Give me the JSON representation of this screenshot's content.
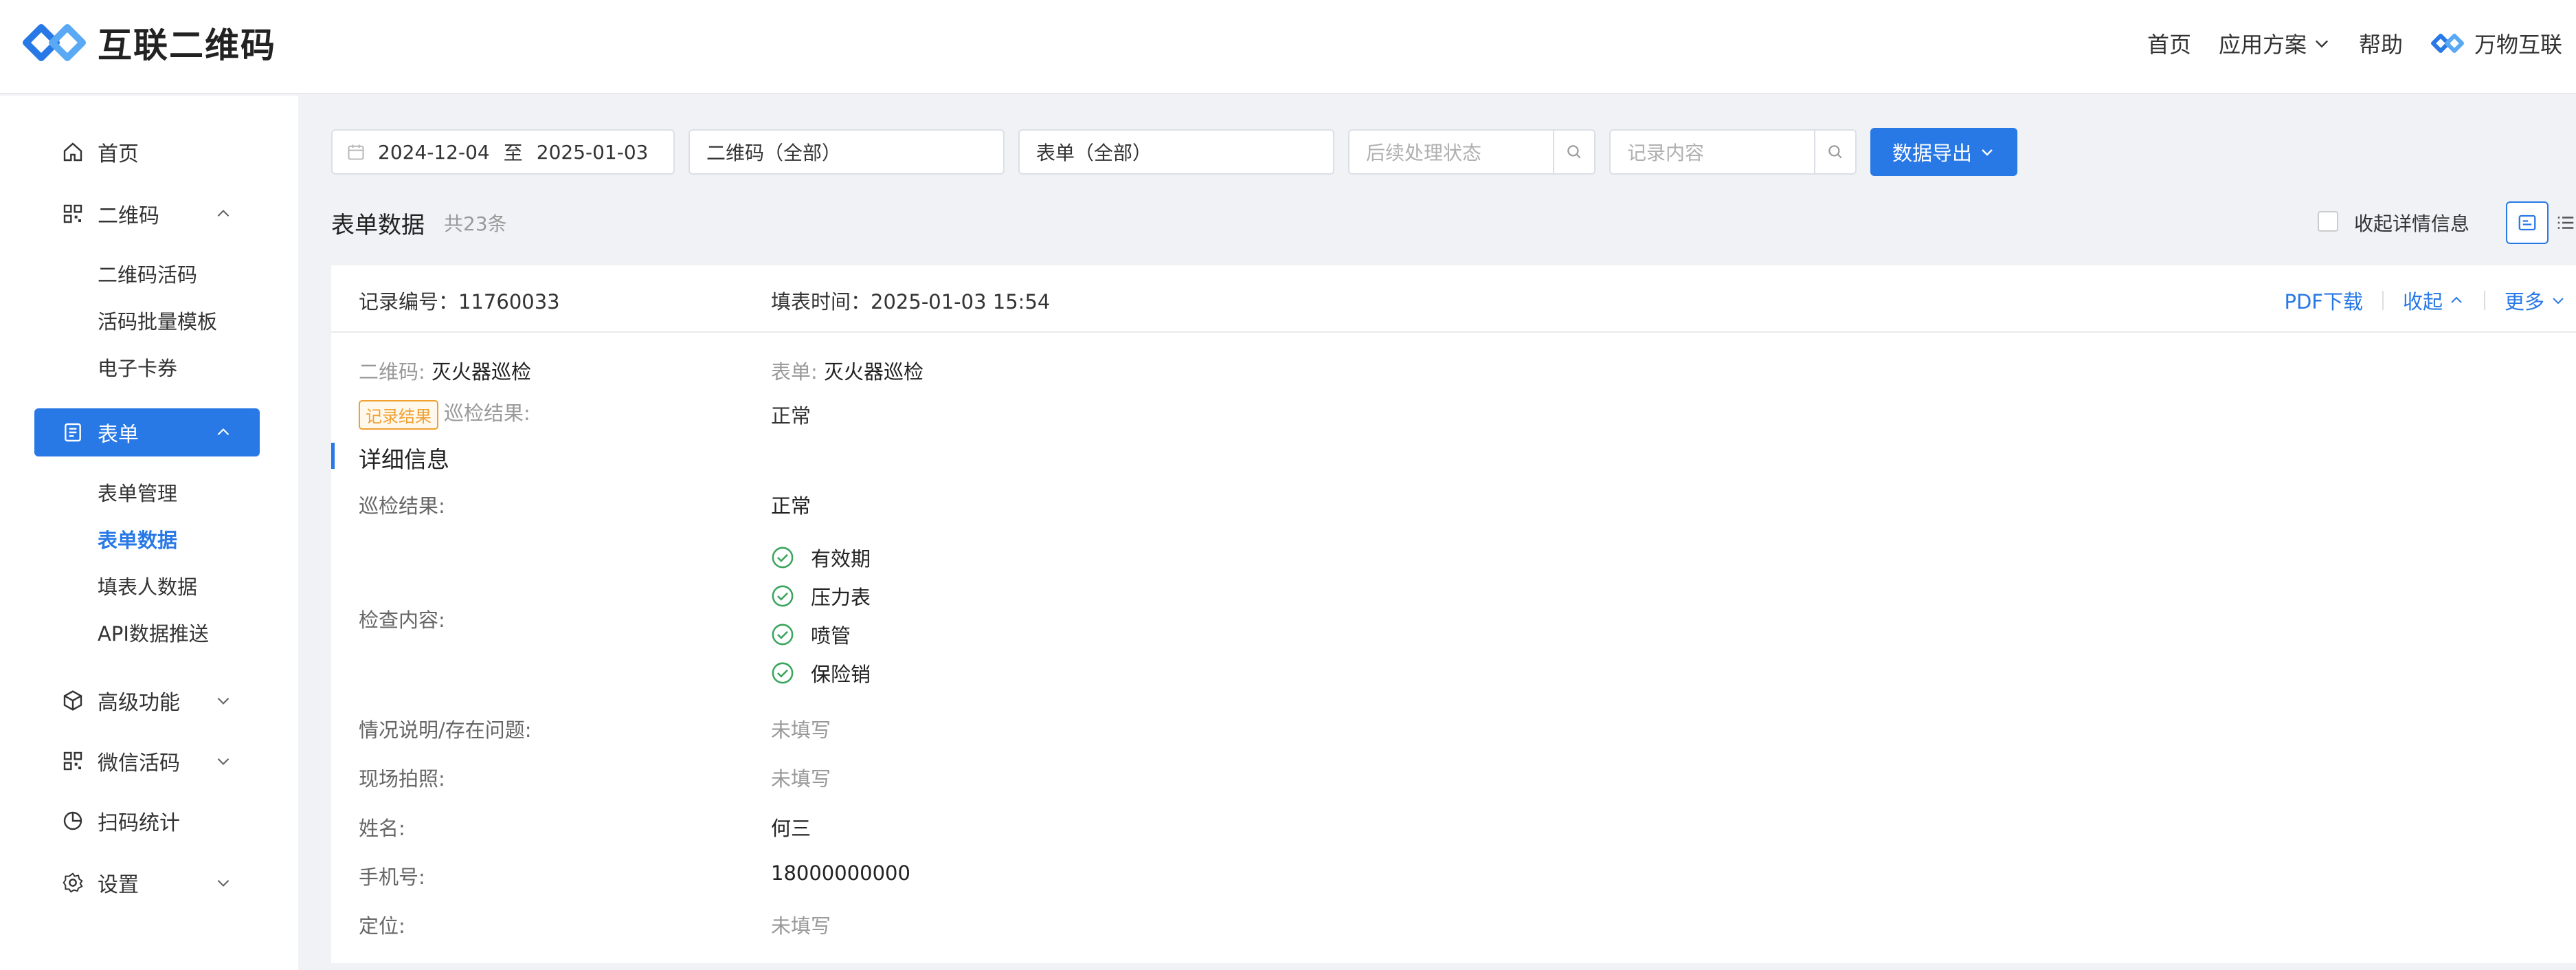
{
  "header": {
    "brand": "互联二维码",
    "nav": [
      {
        "label": "首页"
      },
      {
        "label": "应用方案"
      },
      {
        "label": "帮助"
      },
      {
        "label": "万物互联"
      }
    ]
  },
  "sidebar": {
    "items": [
      {
        "label": "首页",
        "icon": "home-icon"
      },
      {
        "label": "二维码",
        "icon": "qrcode-icon"
      },
      {
        "label": "表单",
        "icon": "form-icon"
      },
      {
        "label": "高级功能",
        "icon": "cube-icon"
      },
      {
        "label": "微信活码",
        "icon": "qrcode-icon"
      },
      {
        "label": "扫码统计",
        "icon": "pie-chart-icon"
      },
      {
        "label": "设置",
        "icon": "gear-icon"
      }
    ],
    "qrcode_sub": [
      "二维码活码",
      "活码批量模板",
      "电子卡券"
    ],
    "form_sub": [
      "表单管理",
      "表单数据",
      "填表人数据",
      "API数据推送"
    ]
  },
  "filters": {
    "date_start": "2024-12-04",
    "date_sep": "至",
    "date_end": "2025-01-03",
    "qrcode_select": "二维码（全部）",
    "form_select": "表单（全部）",
    "status_placeholder": "后续处理状态",
    "content_placeholder": "记录内容",
    "export_label": "数据导出"
  },
  "section": {
    "title": "表单数据",
    "count": "共23条",
    "collapse_label": "收起详情信息"
  },
  "record": {
    "id_label": "记录编号：",
    "id_value": "11760033",
    "time_label": "填表时间：",
    "time_value": "2025-01-03 15:54",
    "actions": {
      "pdf": "PDF下载",
      "collapse": "收起",
      "more": "更多"
    },
    "qrcode_label": "二维码:",
    "qrcode_value": "灭火器巡检",
    "form_label": "表单:",
    "form_value": "灭火器巡检",
    "result_tag": "记录结果",
    "result_label": "巡检结果:",
    "result_value": "正常",
    "detail_title": "详细信息",
    "details": [
      {
        "label": "巡检结果:",
        "value": "正常"
      },
      {
        "label": "检查内容:",
        "checks": [
          "有效期",
          "压力表",
          "喷管",
          "保险销"
        ]
      },
      {
        "label": "情况说明/存在问题:",
        "value": "未填写"
      },
      {
        "label": "现场拍照:",
        "value": "未填写"
      },
      {
        "label": "姓名:",
        "value": "何三"
      },
      {
        "label": "手机号:",
        "value": "18000000000"
      },
      {
        "label": "定位:",
        "value": "未填写"
      }
    ]
  },
  "colors": {
    "primary": "#2878e6",
    "tag_orange": "#f0a030",
    "check_green": "#3aa55d"
  }
}
